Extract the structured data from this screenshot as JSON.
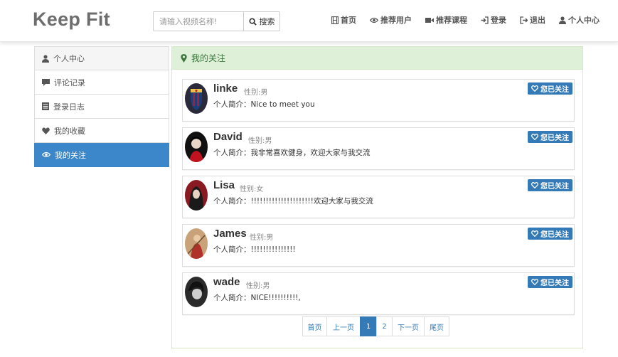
{
  "header": {
    "brand": "Keep Fit",
    "search_placeholder": "请输入视频名称!",
    "search_button": "搜索",
    "nav": [
      {
        "label": "首页",
        "icon": "film-icon"
      },
      {
        "label": "推荐用户",
        "icon": "eye-icon"
      },
      {
        "label": "推荐课程",
        "icon": "video-camera-icon"
      },
      {
        "label": "登录",
        "icon": "log-in-icon"
      },
      {
        "label": "退出",
        "icon": "log-out-icon"
      },
      {
        "label": "个人中心",
        "icon": "user-icon"
      }
    ]
  },
  "sidebar": {
    "items": [
      {
        "label": "个人中心",
        "icon": "user-icon"
      },
      {
        "label": "评论记录",
        "icon": "comment-icon"
      },
      {
        "label": "登录日志",
        "icon": "list-icon"
      },
      {
        "label": "我的收藏",
        "icon": "heart-icon"
      },
      {
        "label": "我的关注",
        "icon": "eye-icon",
        "active": true
      }
    ]
  },
  "main": {
    "title": "我的关注",
    "title_icon": "map-marker-icon",
    "users": [
      {
        "name": "linke",
        "gender": "性别:男",
        "bio": "个人简介：Nice to meet you",
        "follow_label": "您已关注"
      },
      {
        "name": "David",
        "gender": "性别:男",
        "bio": "个人简介：我非常喜欢健身，欢迎大家与我交流",
        "follow_label": "您已关注"
      },
      {
        "name": "Lisa",
        "gender": "性别:女",
        "bio": "个人简介：!!!!!!!!!!!!!!!!!!!!!欢迎大家与我交流",
        "follow_label": "您已关注"
      },
      {
        "name": "James",
        "gender": "性别:男",
        "bio": "个人简介：!!!!!!!!!!!!!!!",
        "follow_label": "您已关注"
      },
      {
        "name": "wade",
        "gender": "性别:男",
        "bio": "个人简介：NICE!!!!!!!!!!,",
        "follow_label": "您已关注"
      }
    ],
    "pagination": {
      "first": "首页",
      "prev": "上一页",
      "pages": [
        "1",
        "2"
      ],
      "current": "1",
      "next": "下一页",
      "last": "尾页"
    }
  },
  "colors": {
    "primary": "#337ab7",
    "sidebar_active": "#3b87c9",
    "panel_heading_bg": "#dff0d8",
    "panel_heading_text": "#3c763d"
  }
}
